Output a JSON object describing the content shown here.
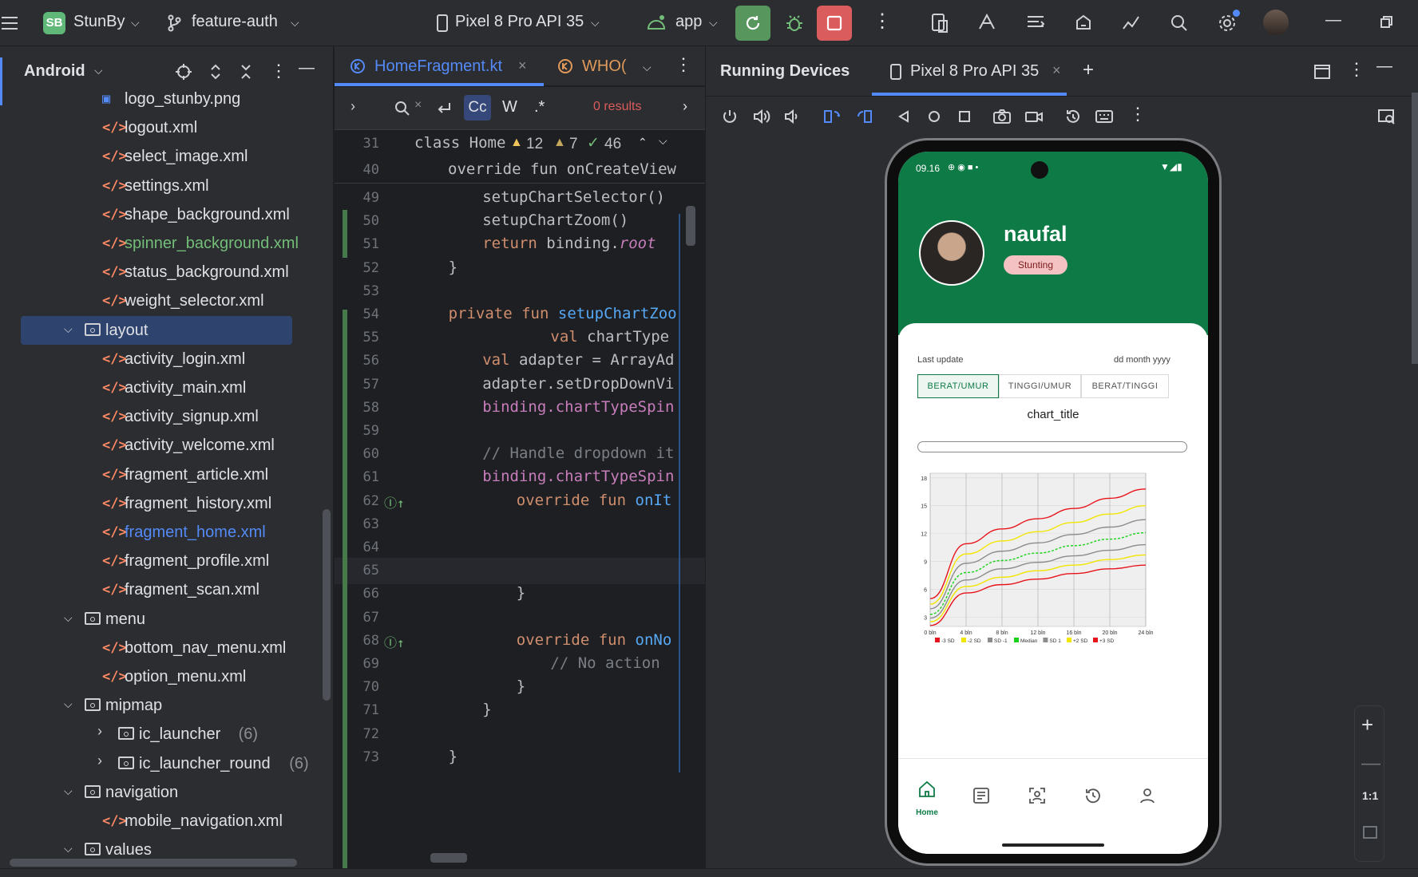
{
  "topbar": {
    "project_badge": "SB",
    "project": "StunBy",
    "branch": "feature-auth",
    "device": "Pixel 8 Pro API 35",
    "run_config": "app"
  },
  "project_panel": {
    "title": "Android",
    "items": [
      {
        "label": "logo_stunby.png",
        "type": "image",
        "color": "#dfe1e5"
      },
      {
        "label": "logout.xml",
        "type": "xml",
        "color": "#dfe1e5"
      },
      {
        "label": "select_image.xml",
        "type": "xml",
        "color": "#dfe1e5"
      },
      {
        "label": "settings.xml",
        "type": "xml",
        "color": "#dfe1e5"
      },
      {
        "label": "shape_background.xml",
        "type": "xml",
        "color": "#dfe1e5"
      },
      {
        "label": "spinner_background.xml",
        "type": "xml",
        "color": "#73bd79"
      },
      {
        "label": "status_background.xml",
        "type": "xml",
        "color": "#dfe1e5"
      },
      {
        "label": "weight_selector.xml",
        "type": "xml",
        "color": "#dfe1e5"
      },
      {
        "label": "layout",
        "type": "folder-open",
        "color": "#dfe1e5"
      },
      {
        "label": "activity_login.xml",
        "type": "xml",
        "color": "#dfe1e5"
      },
      {
        "label": "activity_main.xml",
        "type": "xml",
        "color": "#dfe1e5"
      },
      {
        "label": "activity_signup.xml",
        "type": "xml",
        "color": "#dfe1e5"
      },
      {
        "label": "activity_welcome.xml",
        "type": "xml",
        "color": "#dfe1e5"
      },
      {
        "label": "fragment_article.xml",
        "type": "xml",
        "color": "#dfe1e5"
      },
      {
        "label": "fragment_history.xml",
        "type": "xml",
        "color": "#dfe1e5"
      },
      {
        "label": "fragment_home.xml",
        "type": "xml",
        "color": "#548af7"
      },
      {
        "label": "fragment_profile.xml",
        "type": "xml",
        "color": "#dfe1e5"
      },
      {
        "label": "fragment_scan.xml",
        "type": "xml",
        "color": "#dfe1e5"
      },
      {
        "label": "menu",
        "type": "folder-open",
        "color": "#dfe1e5"
      },
      {
        "label": "bottom_nav_menu.xml",
        "type": "xml",
        "color": "#dfe1e5"
      },
      {
        "label": "option_menu.xml",
        "type": "xml",
        "color": "#dfe1e5"
      },
      {
        "label": "mipmap",
        "type": "folder-open",
        "color": "#dfe1e5"
      },
      {
        "label": "ic_launcher",
        "count": "(6)",
        "type": "folder-closed",
        "color": "#dfe1e5"
      },
      {
        "label": "ic_launcher_round",
        "count": "(6)",
        "type": "folder-closed",
        "color": "#dfe1e5"
      },
      {
        "label": "navigation",
        "type": "folder-open",
        "color": "#dfe1e5"
      },
      {
        "label": "mobile_navigation.xml",
        "type": "xml",
        "color": "#dfe1e5"
      },
      {
        "label": "values",
        "type": "folder-open",
        "color": "#dfe1e5"
      }
    ]
  },
  "editor": {
    "tabs": [
      {
        "label": "HomeFragment.kt"
      },
      {
        "label": "WHO("
      }
    ],
    "find": {
      "cc": "Cc",
      "w": "W",
      "regex": ".*",
      "results": "0 results"
    },
    "sticky": [
      {
        "num": "31",
        "text": "class Home"
      },
      {
        "num": "40",
        "text": "override fun onCreateView"
      }
    ],
    "inspections": {
      "warn1": "12",
      "warn2": "7",
      "ok": "46"
    },
    "lines": [
      {
        "num": "49",
        "indent": 4,
        "parts": [
          {
            "t": "setupChartSelector()",
            "c": "pl"
          }
        ]
      },
      {
        "num": "50",
        "indent": 4,
        "parts": [
          {
            "t": "setupChartZoom()",
            "c": "pl"
          }
        ]
      },
      {
        "num": "51",
        "indent": 4,
        "parts": [
          {
            "t": "return ",
            "c": "kw"
          },
          {
            "t": "binding.",
            "c": "pl"
          },
          {
            "t": "root",
            "c": "pu it"
          }
        ]
      },
      {
        "num": "52",
        "indent": 2,
        "parts": [
          {
            "t": "}",
            "c": "pl"
          }
        ]
      },
      {
        "num": "53",
        "indent": 0,
        "parts": []
      },
      {
        "num": "54",
        "indent": 2,
        "parts": [
          {
            "t": "private fun ",
            "c": "kw"
          },
          {
            "t": "setupChartZoo",
            "c": "fn"
          }
        ]
      },
      {
        "num": "55",
        "indent": 8,
        "parts": [
          {
            "t": "val ",
            "c": "kw"
          },
          {
            "t": "chartType",
            "c": "pl"
          }
        ]
      },
      {
        "num": "56",
        "indent": 4,
        "parts": [
          {
            "t": "val ",
            "c": "kw"
          },
          {
            "t": "adapter = ArrayAd",
            "c": "pl"
          }
        ]
      },
      {
        "num": "57",
        "indent": 4,
        "parts": [
          {
            "t": "adapter.setDropDownVi",
            "c": "pl"
          }
        ]
      },
      {
        "num": "58",
        "indent": 4,
        "parts": [
          {
            "t": "binding.",
            "c": "pu"
          },
          {
            "t": "chartTypeSpin",
            "c": "pu"
          }
        ]
      },
      {
        "num": "59",
        "indent": 0,
        "parts": []
      },
      {
        "num": "60",
        "indent": 4,
        "parts": [
          {
            "t": "// Handle dropdown it",
            "c": "cm"
          }
        ]
      },
      {
        "num": "61",
        "indent": 4,
        "parts": [
          {
            "t": "binding.",
            "c": "pu"
          },
          {
            "t": "chartTypeSpin",
            "c": "pu"
          }
        ]
      },
      {
        "num": "62",
        "indent": 6,
        "parts": [
          {
            "t": "override fun ",
            "c": "kw"
          },
          {
            "t": "onIt",
            "c": "fn"
          }
        ]
      },
      {
        "num": "63",
        "indent": 0,
        "parts": []
      },
      {
        "num": "64",
        "indent": 0,
        "parts": []
      },
      {
        "num": "65",
        "indent": 0,
        "parts": []
      },
      {
        "num": "66",
        "indent": 6,
        "parts": [
          {
            "t": "}",
            "c": "pl"
          }
        ]
      },
      {
        "num": "67",
        "indent": 0,
        "parts": []
      },
      {
        "num": "68",
        "indent": 6,
        "parts": [
          {
            "t": "override fun ",
            "c": "kw"
          },
          {
            "t": "onNo",
            "c": "fn"
          }
        ]
      },
      {
        "num": "69",
        "indent": 8,
        "parts": [
          {
            "t": "// No action",
            "c": "cm"
          }
        ]
      },
      {
        "num": "70",
        "indent": 6,
        "parts": [
          {
            "t": "}",
            "c": "pl"
          }
        ]
      },
      {
        "num": "71",
        "indent": 4,
        "parts": [
          {
            "t": "}",
            "c": "pl"
          }
        ]
      },
      {
        "num": "72",
        "indent": 0,
        "parts": []
      },
      {
        "num": "73",
        "indent": 2,
        "parts": [
          {
            "t": "}",
            "c": "pl"
          }
        ]
      }
    ]
  },
  "devices": {
    "title": "Running Devices",
    "tab": "Pixel 8 Pro API 35",
    "zoom_label": "1:1"
  },
  "phone": {
    "time": "09.16",
    "name": "naufal",
    "status_badge": "Stunting",
    "last_update_label": "Last update",
    "date_value": "dd month yyyy",
    "segments": [
      "BERAT/UMUR",
      "TINGGI/UMUR",
      "BERAT/TINGGI"
    ],
    "chart_title": "chart_title",
    "nav": [
      {
        "label": "Home",
        "icon": "home-icon"
      },
      {
        "label": "",
        "icon": "article-icon"
      },
      {
        "label": "",
        "icon": "scan-icon"
      },
      {
        "label": "",
        "icon": "history-icon"
      },
      {
        "label": "",
        "icon": "profile-icon"
      }
    ],
    "colors": {
      "primary": "#0e7a46",
      "badge": "#f4c2c2"
    }
  },
  "chart_data": {
    "type": "line",
    "title": "",
    "xlabel": "",
    "ylabel": "",
    "x": [
      0,
      4,
      8,
      12,
      16,
      20,
      24
    ],
    "x_tick_labels": [
      "0 bln",
      "4 bln",
      "8 bln",
      "12 bln",
      "16 bln",
      "20 bln",
      "24 bln"
    ],
    "y_ticks": [
      3,
      6,
      9,
      12,
      15,
      18
    ],
    "ylim": [
      2,
      18.5
    ],
    "xlim": [
      0,
      24
    ],
    "series": [
      {
        "name": "-3 SD",
        "color": "#e8141b",
        "dash": false,
        "values": [
          2.1,
          5.6,
          6.5,
          7.1,
          7.7,
          8.2,
          8.6
        ]
      },
      {
        "name": "-2 SD",
        "color": "#f2e600",
        "dash": false,
        "values": [
          2.5,
          6.3,
          7.3,
          8.0,
          8.6,
          9.2,
          9.7
        ]
      },
      {
        "name": "SD -1",
        "color": "#8c8c8c",
        "dash": false,
        "values": [
          2.9,
          7.0,
          8.2,
          8.9,
          9.6,
          10.2,
          10.8
        ]
      },
      {
        "name": "Median",
        "color": "#19d219",
        "dash": true,
        "values": [
          3.3,
          7.8,
          9.1,
          9.9,
          10.7,
          11.4,
          12.1
        ]
      },
      {
        "name": "SD 1",
        "color": "#8c8c8c",
        "dash": false,
        "values": [
          3.9,
          8.8,
          10.1,
          11.0,
          11.9,
          12.7,
          13.5
        ]
      },
      {
        "name": "+2 SD",
        "color": "#f2e600",
        "dash": false,
        "values": [
          4.4,
          9.8,
          11.2,
          12.2,
          13.2,
          14.1,
          15.0
        ]
      },
      {
        "name": "+3 SD",
        "color": "#e8141b",
        "dash": false,
        "values": [
          5.0,
          10.9,
          12.5,
          13.6,
          14.7,
          15.8,
          16.8
        ]
      }
    ],
    "legend": "bottom",
    "grid": true
  }
}
